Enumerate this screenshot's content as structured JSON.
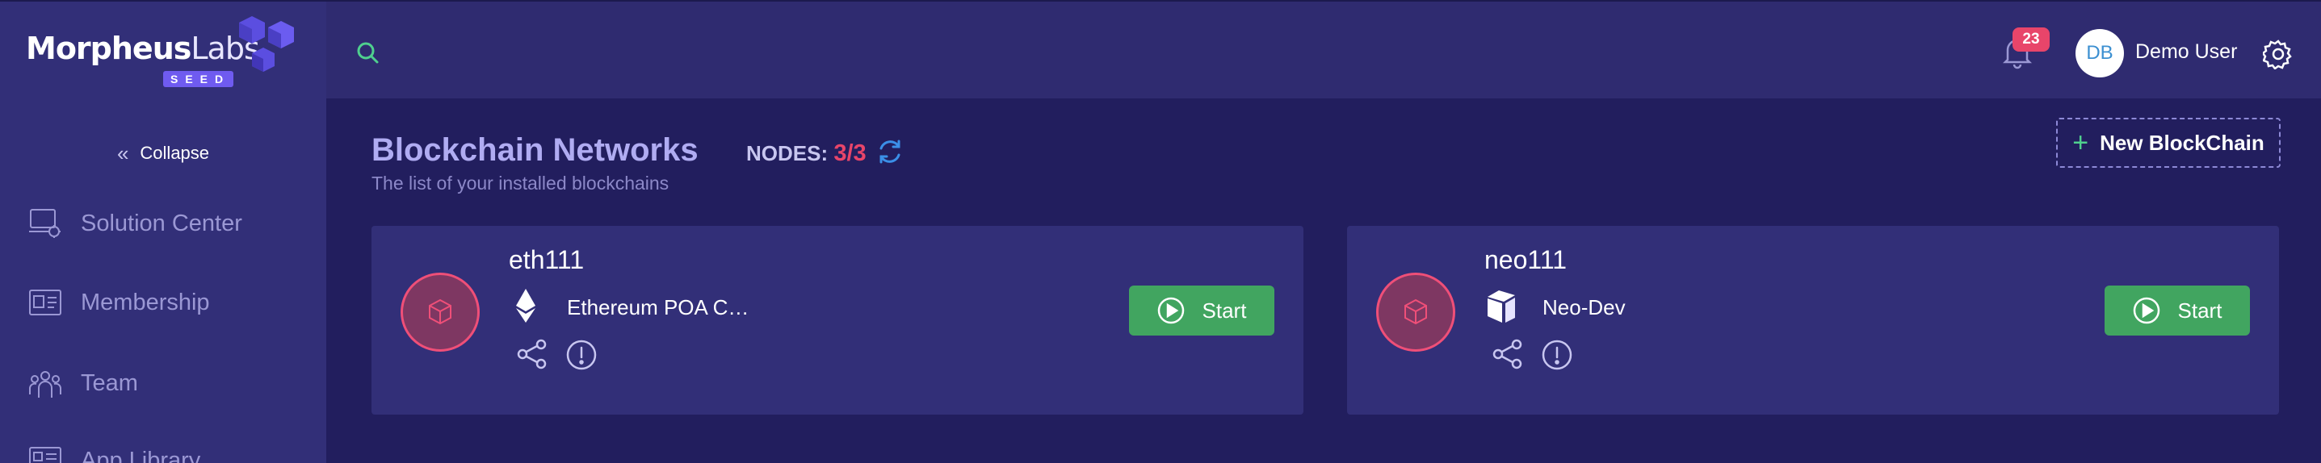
{
  "brand": {
    "name_bold": "Morpheus",
    "name_light": "Labs",
    "tag": "SEED"
  },
  "sidebar": {
    "collapse_label": "Collapse",
    "items": [
      {
        "label": "Solution Center",
        "icon": "solution-center-icon"
      },
      {
        "label": "Membership",
        "icon": "membership-icon"
      },
      {
        "label": "Team",
        "icon": "team-icon"
      },
      {
        "label": "App Library",
        "icon": "app-library-icon"
      }
    ]
  },
  "header": {
    "notification_count": "23",
    "avatar_initials": "DB",
    "user_name": "Demo User"
  },
  "main": {
    "title": "Blockchain Networks",
    "subtitle": "The list of your installed blockchains",
    "nodes_label": "NODES:",
    "nodes_value": "3/3",
    "new_button_label": "New BlockChain"
  },
  "cards": [
    {
      "name": "eth111",
      "type": "Ethereum POA C…",
      "icon": "ethereum-icon",
      "action": "Start"
    },
    {
      "name": "neo111",
      "type": "Neo-Dev",
      "icon": "neo-icon",
      "action": "Start"
    }
  ],
  "colors": {
    "background": "#221e5e",
    "sidebar": "#322f78",
    "accent_red": "#e8456a",
    "start_green": "#41a560",
    "plus_green": "#4fd08e"
  }
}
